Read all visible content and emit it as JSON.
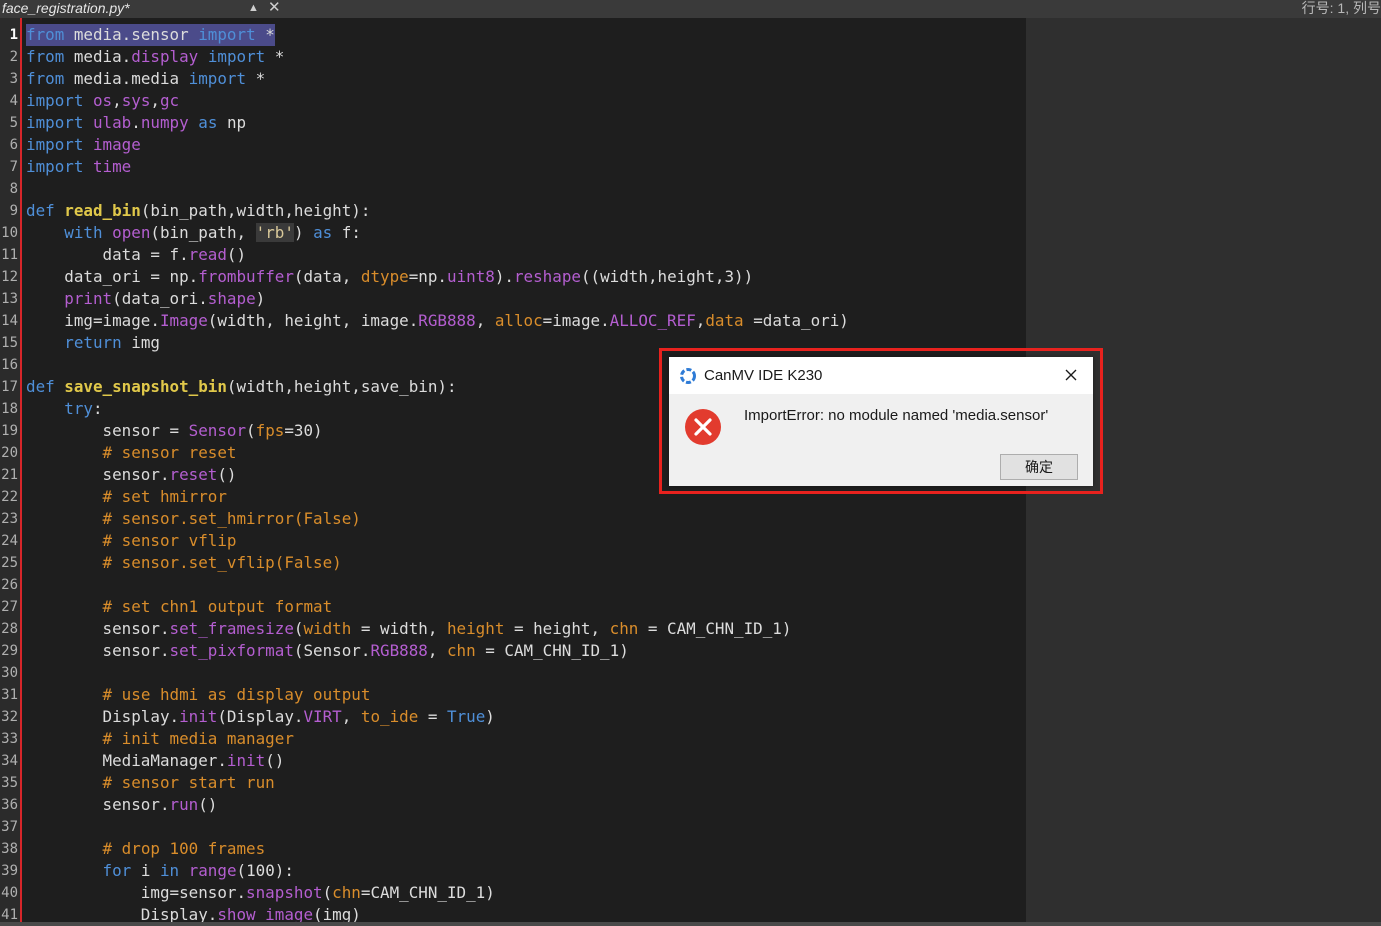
{
  "tab": {
    "title": "face_registration.py*",
    "arrows_icon": "up-down-arrows-icon",
    "close_icon": "close-icon",
    "cursor_position": "行号: 1, 列号"
  },
  "editor": {
    "active_line": 1,
    "line_numbers": [
      "1",
      "2",
      "3",
      "4",
      "5",
      "6",
      "7",
      "8",
      "9",
      "10",
      "11",
      "12",
      "13",
      "14",
      "15",
      "16",
      "17",
      "18",
      "19",
      "20",
      "21",
      "22",
      "23",
      "24",
      "25",
      "26",
      "27",
      "28",
      "29",
      "30",
      "31",
      "32",
      "33",
      "34",
      "35",
      "36",
      "37",
      "38",
      "39",
      "40",
      "41"
    ],
    "lines": [
      [
        [
          "kw",
          "from"
        ],
        [
          "tx",
          " media.sensor "
        ],
        [
          "kw",
          "import"
        ],
        [
          "tx",
          " *"
        ]
      ],
      [
        [
          "kw",
          "from"
        ],
        [
          "tx",
          " media."
        ],
        [
          "bi",
          "display"
        ],
        [
          "tx",
          " "
        ],
        [
          "kw",
          "import"
        ],
        [
          "tx",
          " *"
        ]
      ],
      [
        [
          "kw",
          "from"
        ],
        [
          "tx",
          " media.media "
        ],
        [
          "kw",
          "import"
        ],
        [
          "tx",
          " *"
        ]
      ],
      [
        [
          "kw",
          "import"
        ],
        [
          "tx",
          " "
        ],
        [
          "bi",
          "os"
        ],
        [
          "tx",
          ","
        ],
        [
          "bi",
          "sys"
        ],
        [
          "tx",
          ","
        ],
        [
          "bi",
          "gc"
        ]
      ],
      [
        [
          "kw",
          "import"
        ],
        [
          "tx",
          " "
        ],
        [
          "bi",
          "ulab"
        ],
        [
          "tx",
          "."
        ],
        [
          "bi",
          "numpy"
        ],
        [
          "tx",
          " "
        ],
        [
          "kw",
          "as"
        ],
        [
          "tx",
          " np"
        ]
      ],
      [
        [
          "kw",
          "import"
        ],
        [
          "tx",
          " "
        ],
        [
          "bi",
          "image"
        ]
      ],
      [
        [
          "kw",
          "import"
        ],
        [
          "tx",
          " "
        ],
        [
          "bi",
          "time"
        ]
      ],
      [],
      [
        [
          "kw",
          "def"
        ],
        [
          "tx",
          " "
        ],
        [
          "fn",
          "read_bin"
        ],
        [
          "tx",
          "(bin_path,width,height):"
        ]
      ],
      [
        [
          "tx",
          "    "
        ],
        [
          "kw",
          "with"
        ],
        [
          "tx",
          " "
        ],
        [
          "bi",
          "open"
        ],
        [
          "tx",
          "(bin_path, "
        ],
        [
          "st",
          "'rb'"
        ],
        [
          "tx",
          ") "
        ],
        [
          "kw",
          "as"
        ],
        [
          "tx",
          " f:"
        ]
      ],
      [
        [
          "tx",
          "        data = f."
        ],
        [
          "bi",
          "read"
        ],
        [
          "tx",
          "()"
        ]
      ],
      [
        [
          "tx",
          "    data_ori = np."
        ],
        [
          "bi",
          "frombuffer"
        ],
        [
          "tx",
          "(data, "
        ],
        [
          "pa",
          "dtype"
        ],
        [
          "tx",
          "=np."
        ],
        [
          "bi",
          "uint8"
        ],
        [
          "tx",
          ")."
        ],
        [
          "bi",
          "reshape"
        ],
        [
          "tx",
          "((width,height,3))"
        ]
      ],
      [
        [
          "tx",
          "    "
        ],
        [
          "bi",
          "print"
        ],
        [
          "tx",
          "(data_ori."
        ],
        [
          "bi",
          "shape"
        ],
        [
          "tx",
          ")"
        ]
      ],
      [
        [
          "tx",
          "    img=image."
        ],
        [
          "bi",
          "Image"
        ],
        [
          "tx",
          "(width, height, image."
        ],
        [
          "bi",
          "RGB888"
        ],
        [
          "tx",
          ", "
        ],
        [
          "pa",
          "alloc"
        ],
        [
          "tx",
          "=image."
        ],
        [
          "bi",
          "ALLOC_REF"
        ],
        [
          "tx",
          ","
        ],
        [
          "pa",
          "data"
        ],
        [
          "tx",
          " =data_ori)"
        ]
      ],
      [
        [
          "tx",
          "    "
        ],
        [
          "kw",
          "return"
        ],
        [
          "tx",
          " img"
        ]
      ],
      [],
      [
        [
          "kw",
          "def"
        ],
        [
          "tx",
          " "
        ],
        [
          "fn",
          "save_snapshot_bin"
        ],
        [
          "tx",
          "(width,height,save_bin):"
        ]
      ],
      [
        [
          "tx",
          "    "
        ],
        [
          "kw",
          "try"
        ],
        [
          "tx",
          ":"
        ]
      ],
      [
        [
          "tx",
          "        sensor = "
        ],
        [
          "bi",
          "Sensor"
        ],
        [
          "tx",
          "("
        ],
        [
          "pa",
          "fps"
        ],
        [
          "tx",
          "=30)"
        ]
      ],
      [
        [
          "tx",
          "        "
        ],
        [
          "cm",
          "# sensor reset"
        ]
      ],
      [
        [
          "tx",
          "        sensor."
        ],
        [
          "bi",
          "reset"
        ],
        [
          "tx",
          "()"
        ]
      ],
      [
        [
          "tx",
          "        "
        ],
        [
          "cm",
          "# set hmirror"
        ]
      ],
      [
        [
          "tx",
          "        "
        ],
        [
          "cm",
          "# sensor.set_hmirror(False)"
        ]
      ],
      [
        [
          "tx",
          "        "
        ],
        [
          "cm",
          "# sensor vflip"
        ]
      ],
      [
        [
          "tx",
          "        "
        ],
        [
          "cm",
          "# sensor.set_vflip(False)"
        ]
      ],
      [],
      [
        [
          "tx",
          "        "
        ],
        [
          "cm",
          "# set chn1 output format"
        ]
      ],
      [
        [
          "tx",
          "        sensor."
        ],
        [
          "bi",
          "set_framesize"
        ],
        [
          "tx",
          "("
        ],
        [
          "pa",
          "width"
        ],
        [
          "tx",
          " = width, "
        ],
        [
          "pa",
          "height"
        ],
        [
          "tx",
          " = height, "
        ],
        [
          "pa",
          "chn"
        ],
        [
          "tx",
          " = CAM_CHN_ID_1)"
        ]
      ],
      [
        [
          "tx",
          "        sensor."
        ],
        [
          "bi",
          "set_pixformat"
        ],
        [
          "tx",
          "(Sensor."
        ],
        [
          "bi",
          "RGB888"
        ],
        [
          "tx",
          ", "
        ],
        [
          "pa",
          "chn"
        ],
        [
          "tx",
          " = CAM_CHN_ID_1)"
        ]
      ],
      [],
      [
        [
          "tx",
          "        "
        ],
        [
          "cm",
          "# use hdmi as display output"
        ]
      ],
      [
        [
          "tx",
          "        Display."
        ],
        [
          "bi",
          "init"
        ],
        [
          "tx",
          "(Display."
        ],
        [
          "bi",
          "VIRT"
        ],
        [
          "tx",
          ", "
        ],
        [
          "pa",
          "to_ide"
        ],
        [
          "tx",
          " = "
        ],
        [
          "kw",
          "True"
        ],
        [
          "tx",
          ")"
        ]
      ],
      [
        [
          "tx",
          "        "
        ],
        [
          "cm",
          "# init media manager"
        ]
      ],
      [
        [
          "tx",
          "        MediaManager."
        ],
        [
          "bi",
          "init"
        ],
        [
          "tx",
          "()"
        ]
      ],
      [
        [
          "tx",
          "        "
        ],
        [
          "cm",
          "# sensor start run"
        ]
      ],
      [
        [
          "tx",
          "        sensor."
        ],
        [
          "bi",
          "run"
        ],
        [
          "tx",
          "()"
        ]
      ],
      [],
      [
        [
          "tx",
          "        "
        ],
        [
          "cm",
          "# drop 100 frames"
        ]
      ],
      [
        [
          "tx",
          "        "
        ],
        [
          "kw",
          "for"
        ],
        [
          "tx",
          " i "
        ],
        [
          "kw",
          "in"
        ],
        [
          "tx",
          " "
        ],
        [
          "bi",
          "range"
        ],
        [
          "tx",
          "(100):"
        ]
      ],
      [
        [
          "tx",
          "            img=sensor."
        ],
        [
          "bi",
          "snapshot"
        ],
        [
          "tx",
          "("
        ],
        [
          "pa",
          "chn"
        ],
        [
          "tx",
          "=CAM_CHN_ID_1)"
        ]
      ],
      [
        [
          "tx",
          "            Display."
        ],
        [
          "bi",
          "show_image"
        ],
        [
          "tx",
          "(img)"
        ]
      ]
    ]
  },
  "dialog": {
    "title": "CanMV IDE K230",
    "logo_icon": "canmv-logo-icon",
    "error_icon": "error-icon",
    "message": "ImportError: no module named 'media.sensor'",
    "ok_label": "确定",
    "highlight_color": "#e8221e"
  }
}
